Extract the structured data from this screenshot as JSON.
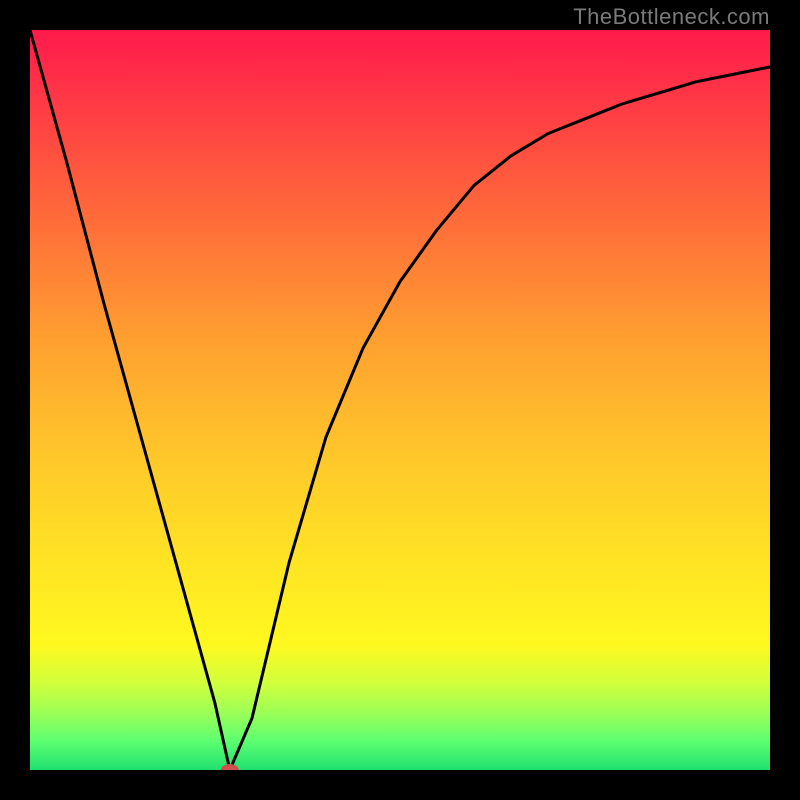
{
  "watermark": "TheBottleneck.com",
  "chart_data": {
    "type": "line",
    "title": "",
    "xlabel": "",
    "ylabel": "",
    "xlim": [
      0,
      100
    ],
    "ylim": [
      0,
      100
    ],
    "series": [
      {
        "name": "bottleneck-curve",
        "x": [
          0,
          5,
          10,
          15,
          20,
          25,
          27,
          30,
          35,
          40,
          45,
          50,
          55,
          60,
          65,
          70,
          75,
          80,
          85,
          90,
          95,
          100
        ],
        "values": [
          100,
          82,
          63,
          45,
          27,
          9,
          0,
          7,
          28,
          45,
          57,
          66,
          73,
          79,
          83,
          86,
          88,
          90,
          91.5,
          93,
          94,
          95
        ]
      }
    ],
    "marker": {
      "x": 27,
      "y": 0
    },
    "background_gradient": {
      "top": "#ff1a4b",
      "mid_upper": "#ffa030",
      "mid": "#ffe424",
      "mid_lower": "#d4ff3a",
      "bottom": "#20e070"
    }
  }
}
